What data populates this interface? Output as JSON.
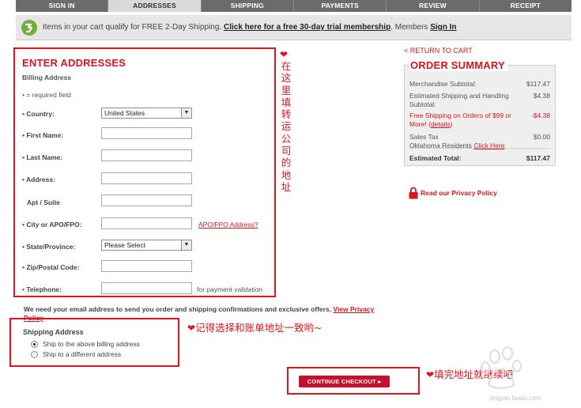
{
  "steps": [
    "SIGN IN",
    "ADDRESSES",
    "SHIPPING",
    "PAYMENTS",
    "REVIEW",
    "RECEIPT"
  ],
  "promo": {
    "message": "Items in your cart qualify for FREE 2-Day Shipping.",
    "link": "Click here for a free 30-day trial membership",
    "members": ". Members",
    "sign_in": "Sign In"
  },
  "form": {
    "title": "ENTER ADDRESSES",
    "billing_label": "Billing Address",
    "required_note": "= required field",
    "country_label": "Country:",
    "country_value": "United States",
    "first_name_label": "First Name:",
    "last_name_label": "Last Name:",
    "address_label": "Address:",
    "apt_label": "Apt / Suite",
    "city_label": "City or APO/FPO:",
    "apo_link": "APO/FPO Address?",
    "state_label": "State/Province:",
    "state_value": "Please Select",
    "zip_label": "Zip/Postal Code:",
    "phone_label": "Telephone:",
    "phone_hint": "for payment validation"
  },
  "email_note": {
    "text": "We need your email address to send you order and shipping confirmations and exclusive offers.",
    "link": "View Privacy Policy"
  },
  "shipping": {
    "title": "Shipping Address",
    "option1": "Ship to the above billing address",
    "option2": "Ship to a different address"
  },
  "continue_label": "CONTINUE CHECKOUT",
  "summary": {
    "return_link": "< RETURN TO CART",
    "title": "ORDER SUMMARY",
    "merch_label": "Merchandise Subtotal:",
    "merch_value": "$117.47",
    "ship_label": "Estimated Shipping and Handling Subtotal:",
    "ship_value": "$4.38",
    "free_label": "Free Shipping on Orders of $99 or More!",
    "details": "details",
    "free_value": "-$4.38",
    "tax_label": "Sales Tax",
    "tax_value": "$0.00",
    "tax_region": "Oklahoma Residents",
    "click_here": "Click Here",
    "total_label": "Estimated Total:",
    "total_value": "$117.47",
    "privacy": "Read our Privacy Policy"
  },
  "annotations": {
    "vertical": [
      "在",
      "这",
      "里",
      "填",
      "转",
      "运",
      "公",
      "司",
      "的",
      "地",
      "址"
    ],
    "shipping_note": "记得选择和账单地址一致哟~",
    "continue_note": "填完地址就继续吧"
  },
  "watermark": "jingyan.baidu.com",
  "colors": {
    "accent_red": "#d8141e",
    "tab_bar": "#6b6b6b",
    "cta": "#c8102e"
  }
}
